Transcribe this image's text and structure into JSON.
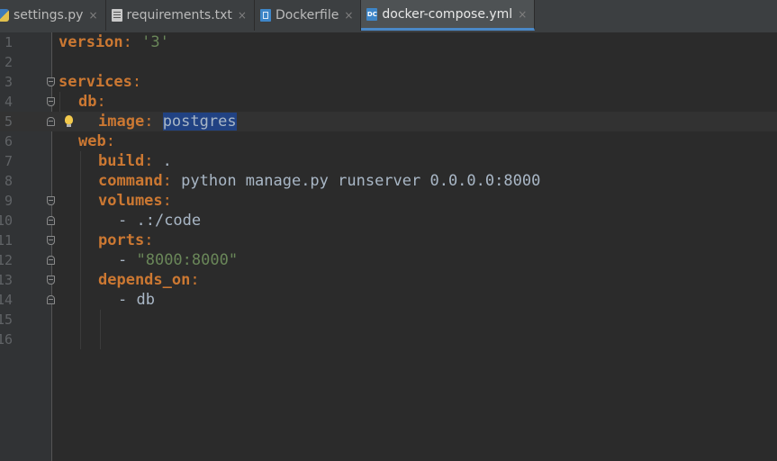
{
  "tabs": [
    {
      "label": "settings.py",
      "icon": "python-file-icon",
      "active": false
    },
    {
      "label": "requirements.txt",
      "icon": "text-file-icon",
      "active": false
    },
    {
      "label": "Dockerfile",
      "icon": "dockerfile-icon",
      "active": false
    },
    {
      "label": "docker-compose.yml",
      "icon": "docker-compose-icon",
      "active": true
    }
  ],
  "tab_close_glyph": "×",
  "docker_compose_badge": "DC",
  "line_numbers": [
    "1",
    "2",
    "3",
    "4",
    "5",
    "6",
    "7",
    "8",
    "9",
    "10",
    "11",
    "12",
    "13",
    "14",
    "15",
    "16"
  ],
  "code": {
    "l1": {
      "key": "version",
      "colon": ":",
      "value": "'3'"
    },
    "l3": {
      "key": "services",
      "colon": ":"
    },
    "l4": {
      "key": "db",
      "colon": ":"
    },
    "l5": {
      "key": "image",
      "colon": ":",
      "value": "postgres"
    },
    "l6": {
      "key": "web",
      "colon": ":"
    },
    "l7": {
      "key": "build",
      "colon": ":",
      "value": " ."
    },
    "l8": {
      "key": "command",
      "colon": ":",
      "value": " python manage.py runserver 0.0.0.0:8000"
    },
    "l9": {
      "key": "volumes",
      "colon": ":"
    },
    "l10": {
      "dash": "- ",
      "value": ".:/code"
    },
    "l11": {
      "key": "ports",
      "colon": ":"
    },
    "l12": {
      "dash": "- ",
      "value": "\"8000:8000\""
    },
    "l13": {
      "key": "depends_on",
      "colon": ":"
    },
    "l14": {
      "dash": "- ",
      "value": "db"
    }
  },
  "colors": {
    "background": "#2b2b2b",
    "keyword": "#cc7832",
    "string": "#6a8759",
    "text": "#a9b7c6",
    "selection": "#214283",
    "active_tab_underline": "#4a88c7"
  }
}
